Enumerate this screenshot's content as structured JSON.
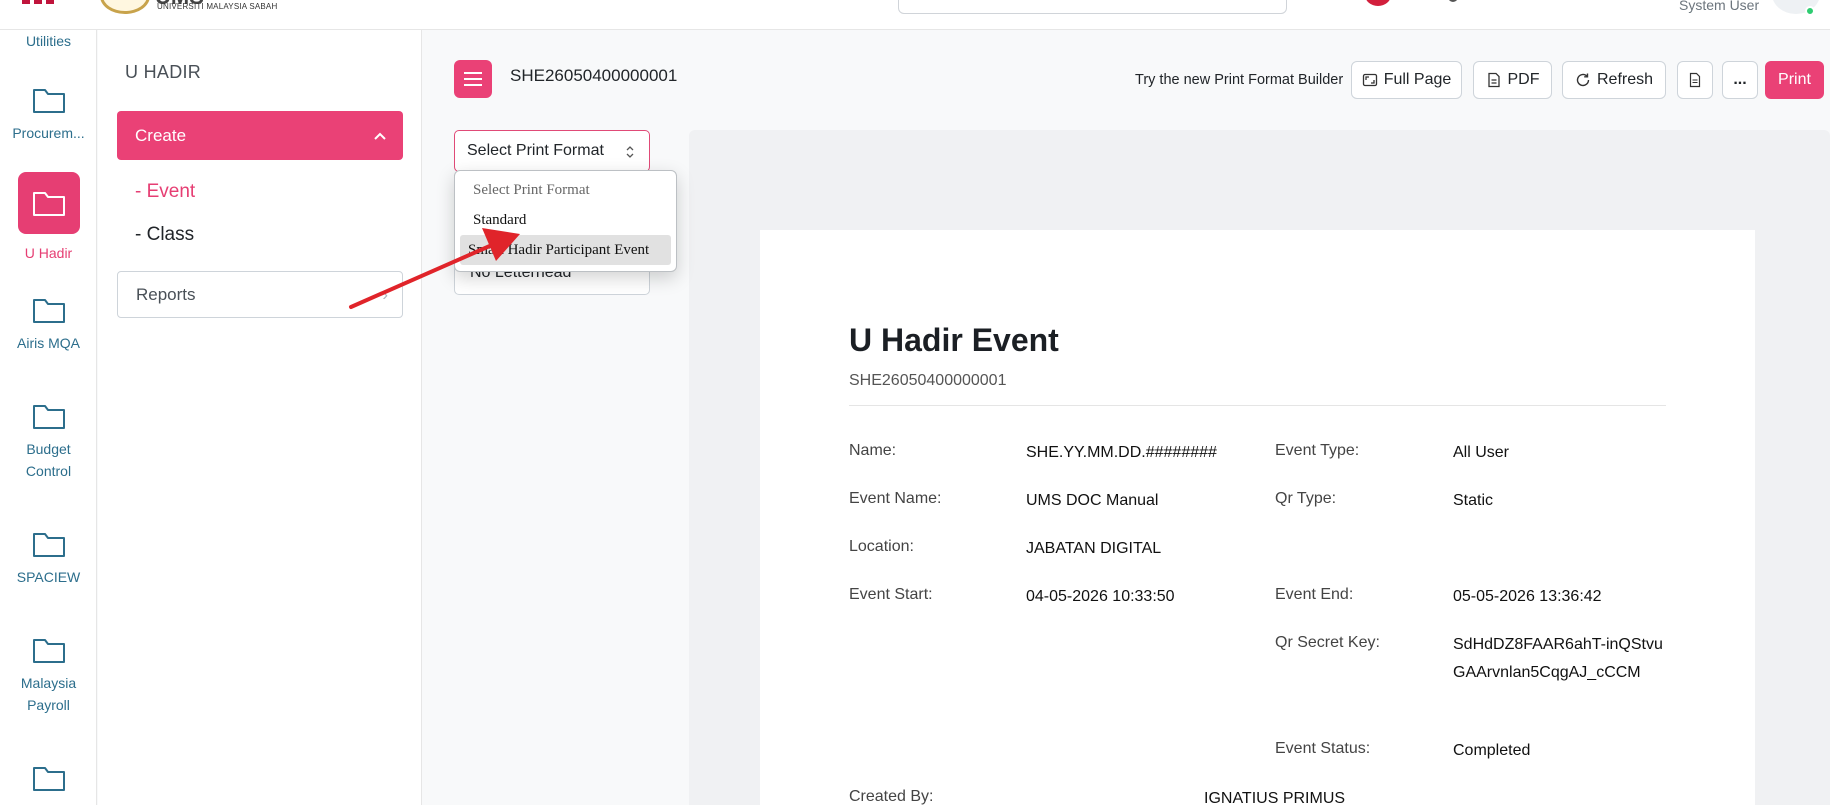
{
  "header": {
    "logo_text": "UMS",
    "logo_subtitle": "UNIVERSITI MALAYSIA SABAH",
    "user_role": "System User"
  },
  "rail": {
    "items": [
      {
        "label": "Utilities"
      },
      {
        "label": "Procurem..."
      },
      {
        "label": "U Hadir"
      },
      {
        "label": "Airis MQA"
      },
      {
        "label": "Budget Control"
      },
      {
        "label": "SPACIEW"
      },
      {
        "label": "Malaysia Payroll"
      }
    ]
  },
  "sidebar": {
    "title": "U HADIR",
    "create_label": "Create",
    "sub_items": [
      {
        "label": "- Event"
      },
      {
        "label": "- Class"
      }
    ],
    "reports_label": "Reports"
  },
  "toolbar": {
    "doc_id": "SHE26050400000001",
    "try_builder": "Try the new Print Format Builder",
    "full_page": "Full Page",
    "pdf": "PDF",
    "refresh": "Refresh",
    "more": "...",
    "print": "Print"
  },
  "print_format": {
    "selected": "Select Print Format",
    "options": [
      "Select Print Format",
      "Standard",
      "Smart Hadir Participant Event"
    ],
    "letterhead": "No Letterhead"
  },
  "document": {
    "title": "U Hadir Event",
    "subtitle": "SHE26050400000001",
    "fields": {
      "name_label": "Name:",
      "name_value": "SHE.YY.MM.DD.########",
      "event_type_label": "Event Type:",
      "event_type_value": "All User",
      "event_name_label": "Event Name:",
      "event_name_value": "UMS DOC Manual",
      "qr_type_label": "Qr Type:",
      "qr_type_value": "Static",
      "location_label": "Location:",
      "location_value": "JABATAN DIGITAL",
      "event_start_label": "Event Start:",
      "event_start_value": "04-05-2026 10:33:50",
      "event_end_label": "Event End:",
      "event_end_value": "05-05-2026 13:36:42",
      "qr_secret_label": "Qr Secret Key:",
      "qr_secret_value": "SdHdDZ8FAAR6ahT-inQStvuGAArvnlan5CqgAJ_cCCM",
      "event_status_label": "Event Status:",
      "event_status_value": "Completed",
      "created_by_label": "Created By:",
      "created_by_value": "IGNATIUS PRIMUS"
    }
  },
  "colors": {
    "accent": "#ea4176",
    "rail_text": "#2c6e8c",
    "annotation_arrow": "#e0242a"
  }
}
